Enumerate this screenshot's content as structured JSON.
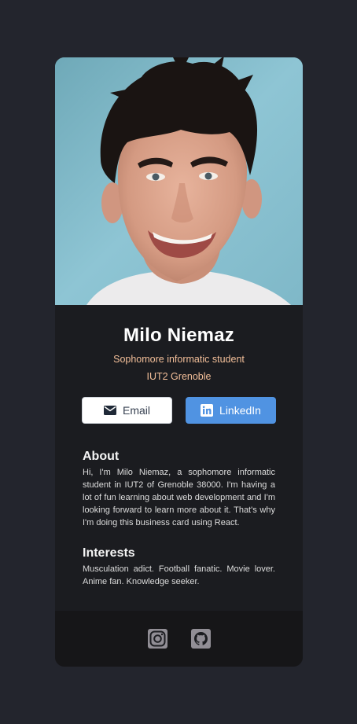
{
  "profile": {
    "name": "Milo Niemaz",
    "role": "Sophomore informatic student",
    "school": "IUT2 Grenoble"
  },
  "buttons": {
    "email_label": "Email",
    "linkedin_label": "LinkedIn",
    "email_icon": "envelope-icon",
    "linkedin_icon": "linkedin-icon"
  },
  "about": {
    "title": "About",
    "text": "Hi, I'm Milo Niemaz, a sophomore informatic student in IUT2 of Grenoble 38000. I'm having a lot of fun learning about web development and I'm looking forward to learn more about it. That's why I'm doing this business card using React."
  },
  "interests": {
    "title": "Interests",
    "text": "Musculation adict. Football fanatic. Movie lover. Anime fan. Knowledge seeker."
  },
  "footer": {
    "icons": [
      "instagram-icon",
      "github-icon"
    ]
  },
  "colors": {
    "page_bg": "#23252d",
    "card_bg": "#1b1c20",
    "footer_bg": "#161618",
    "accent": "#f3bf99",
    "linkedin": "#5093e2"
  }
}
